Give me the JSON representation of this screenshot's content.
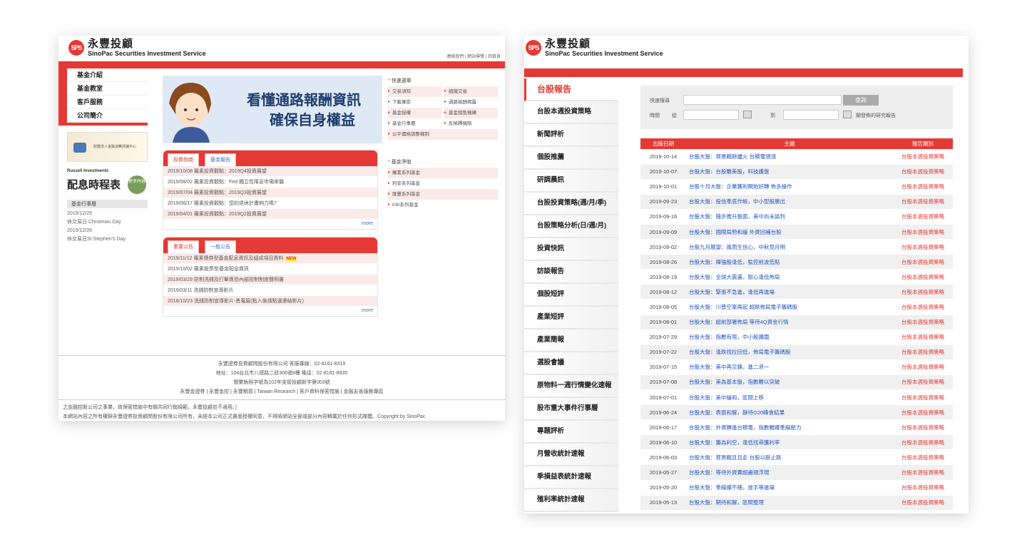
{
  "brand": {
    "cn": "永豐投顧",
    "en": "SinoPac Securities Investment Service",
    "mark": "SPS"
  },
  "left": {
    "toplinks": "連絡我們 | 網站導覽 | 回首頁",
    "nav": [
      "基金介紹",
      "基金教室",
      "客戶服務",
      "公司簡介"
    ],
    "banner": {
      "line1": "看懂通路報酬資訊",
      "line2": "確保自身權益"
    },
    "book_caption": "財團法人金融消費評議中心",
    "dividend": {
      "brand": "Russell Investments",
      "title": "配息時程表",
      "badge": "更多內容"
    },
    "calendar": {
      "head": "基金行事曆",
      "rows": [
        "2019/12/25",
        "休交易日 Christmas Day",
        "2019/12/26",
        "休交易日St Stephen's Day"
      ]
    },
    "box1": {
      "tabs": [
        "投資指南",
        "基金報告"
      ],
      "rows": [
        "2019/10/08  羅素投資觀點：2019Q4投資展望",
        "2019/08/02  羅素投資觀點：Fed 獨立性降息市場來襲",
        "2019/07/04  羅素投資觀點：2019Q3投資展望",
        "2019/06/17  羅素投資觀點：您的退休計畫夠力嗎?",
        "2019/04/01  羅素投資觀點：2019Q2投資展望"
      ],
      "more": "more"
    },
    "box2": {
      "tabs": [
        "重要公告",
        "一般公告"
      ],
      "rows": [
        "2019/11/12  羅素債券型基金配息資訊及組成項目資料",
        "2019/10/02  羅素股票型基金配息資訊",
        "2019/03/29  防制洗錢及打擊資恐內部控制制度聲明書",
        "2019/03/11  洗錢防制宣導影片",
        "2018/10/23  洗錢防制宣導影片-勇蒐篇(點入後請點選連結影片)"
      ],
      "new_badge": "NEW",
      "more": "more"
    },
    "quick1": {
      "title": "快速選單",
      "items": [
        "交易須知",
        "組織交易",
        "下載專區",
        "通路報酬揭露",
        "基金授權",
        "基金銷售機構",
        "基金行事曆",
        "反稀釋機制",
        "公平價格調整機制"
      ]
    },
    "quick2": {
      "title": "基金淨值",
      "items": [
        "羅素系列基金",
        "利安系列基金",
        "匯豐系列基金",
        "KBI系列基金"
      ]
    },
    "footer": {
      "lines": [
        "永豐證券投資顧問股份有限公司  客服專線：02-8161-8319",
        "地址：104台北市八德路二段306號8樓  電話：02-8161-8935",
        "營業執照字號為102年金管投顧新字第003號"
      ],
      "links": "永豐金證券 | 永豐金控 | 永豐期貨 | Taiwan Research | 客戶資料保密措施 | 金融友善服務專區",
      "bottom": [
        "之金融控股公司之事業，故保密措施中有關共同行銷規範，永豐投顧並不適用。)",
        "本網站內容之所有權歸永豐證券投資顧問股份有限公司所有，未經本公司正式書面授權同意，不得將網站全部或部分內容轉載於任何形式媒體。Copyright by SinoPac"
      ]
    }
  },
  "right": {
    "nav": [
      "台股報告",
      "台股本週投資策略",
      "新聞評析",
      "個股推薦",
      "研調晨訊",
      "台股投資策略(週/月/季)",
      "台股策略分析(日/週/月)",
      "投資快訊",
      "訪談報告",
      "個股短評",
      "產業短評",
      "產業簡報",
      "選股會議",
      "原物料一週行情變化速報",
      "股市重大事件行事曆",
      "專題評析",
      "月營收統計速報",
      "季損益表統計速報",
      "殖利率統計速報"
    ],
    "search": {
      "label_kw": "快速搜尋",
      "button": "查詢",
      "label_time": "時間",
      "from": "從",
      "to": "到",
      "hint": "關發佈的研究報告"
    },
    "table": {
      "headers": [
        "出版日期",
        "主題",
        "報告類別"
      ],
      "rows": [
        [
          "2019-10-14",
          "台股大盤：貿易戰餘燼火 台積電領漲",
          "台股本週投資策略"
        ],
        [
          "2019-10-07",
          "台股大盤：台股雖美股，科技護盤",
          "台股本週投資策略"
        ],
        [
          "2019-10-01",
          "台股十月大盤：企業獲利開始好轉 佈多操作",
          "台股本週投資策略"
        ],
        [
          "2019-09-23",
          "台股大盤：投信季底作帳，中小型股勝出",
          "台股本週投資策略"
        ],
        [
          "2019-09-16",
          "台股大盤：穩步推升盤面，美中尚未談判",
          "台股本週投資策略"
        ],
        [
          "2019-09-09",
          "台股大盤：國際局勢和緩 外資回補台股",
          "台股本週投資策略"
        ],
        [
          "2019-09-02",
          "台股九月展望：風雨生信心，中秋見月明",
          "台股本週投資策略"
        ],
        [
          "2019-08-26",
          "台股大盤：擇強股逢低，監控前波低點",
          "台股本週投資策略"
        ],
        [
          "2019-08-19",
          "台股大盤：全球大震盪，耐心逢低佈局",
          "台股本週投資策略"
        ],
        [
          "2019-08-12",
          "台股大盤：緊張不急進，逢低再進場",
          "台股本週投資策略"
        ],
        [
          "2019-08-05",
          "台股大盤：川普空軍再起 超跌佈局電子籌碼股",
          "台股本週投資策略"
        ],
        [
          "2019-08-01",
          "台股大盤：超前部署佈局 等待4Q資金行情",
          "台股本週投資策略"
        ],
        [
          "2019-07-29",
          "台股大盤：指數有限，中小股擴圍",
          "台股本週投資策略"
        ],
        [
          "2019-07-22",
          "台股大盤：逢跌找拉回低，佈局電子籌碼股",
          "台股本週投資策略"
        ],
        [
          "2019-07-15",
          "台股大盤：美中再交鋒，進二退一",
          "台股本週投資策略"
        ],
        [
          "2019-07-08",
          "台股大盤：美為基本盤，指數難以突破",
          "台股本週投資策略"
        ],
        [
          "2019-07-01",
          "台股大盤：美中緩和，區間上移",
          "台股本週投資策略"
        ],
        [
          "2019-06-24",
          "台股大盤：表面和解，靜待G20峰會結果",
          "台股本週投資策略"
        ],
        [
          "2019-06-17",
          "台股大盤：外資轉進台積電，指數難躍季線壓力",
          "台股本週投資策略"
        ],
        [
          "2019-06-10",
          "台股大盤：籌為利空，逢低找尋獲利率",
          "台股本週投資策略"
        ],
        [
          "2019-06-03",
          "台股大盤：貿易戰且且走 台股以跌止跌",
          "台股本週投資策略"
        ],
        [
          "2019-05-27",
          "台股大盤：等待外資賣超盡頭浮現",
          "台股本週投資策略"
        ],
        [
          "2019-05-20",
          "台股大盤：季線擴不穩，放手等進場",
          "台股本週投資策略"
        ],
        [
          "2019-05-13",
          "台股大盤：期待和解，區間整理",
          "台股本週投資策略"
        ]
      ]
    }
  },
  "colors": {
    "accent": "#e53935",
    "link": "#2253c4"
  }
}
